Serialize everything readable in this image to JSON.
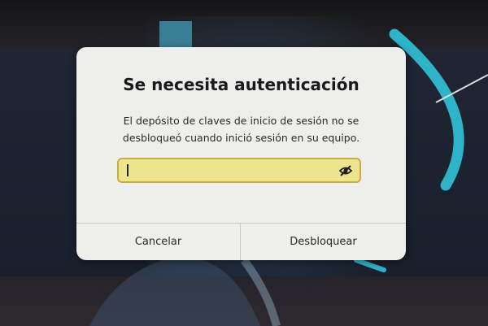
{
  "dialog": {
    "title": "Se necesita autenticación",
    "message_line1": "El depósito de claves de inicio de sesión no se",
    "message_line2": "desbloqueó cuando inició sesión en su equipo.",
    "password": {
      "value": "",
      "placeholder": "",
      "reveal_icon": "eye-slash-icon",
      "field_color": "#ece58e",
      "border_color": "#c9ae3e"
    },
    "buttons": {
      "cancel_label": "Cancelar",
      "unlock_label": "Desbloquear"
    }
  },
  "wallpaper": {
    "accent_color": "#2fb3c9"
  }
}
